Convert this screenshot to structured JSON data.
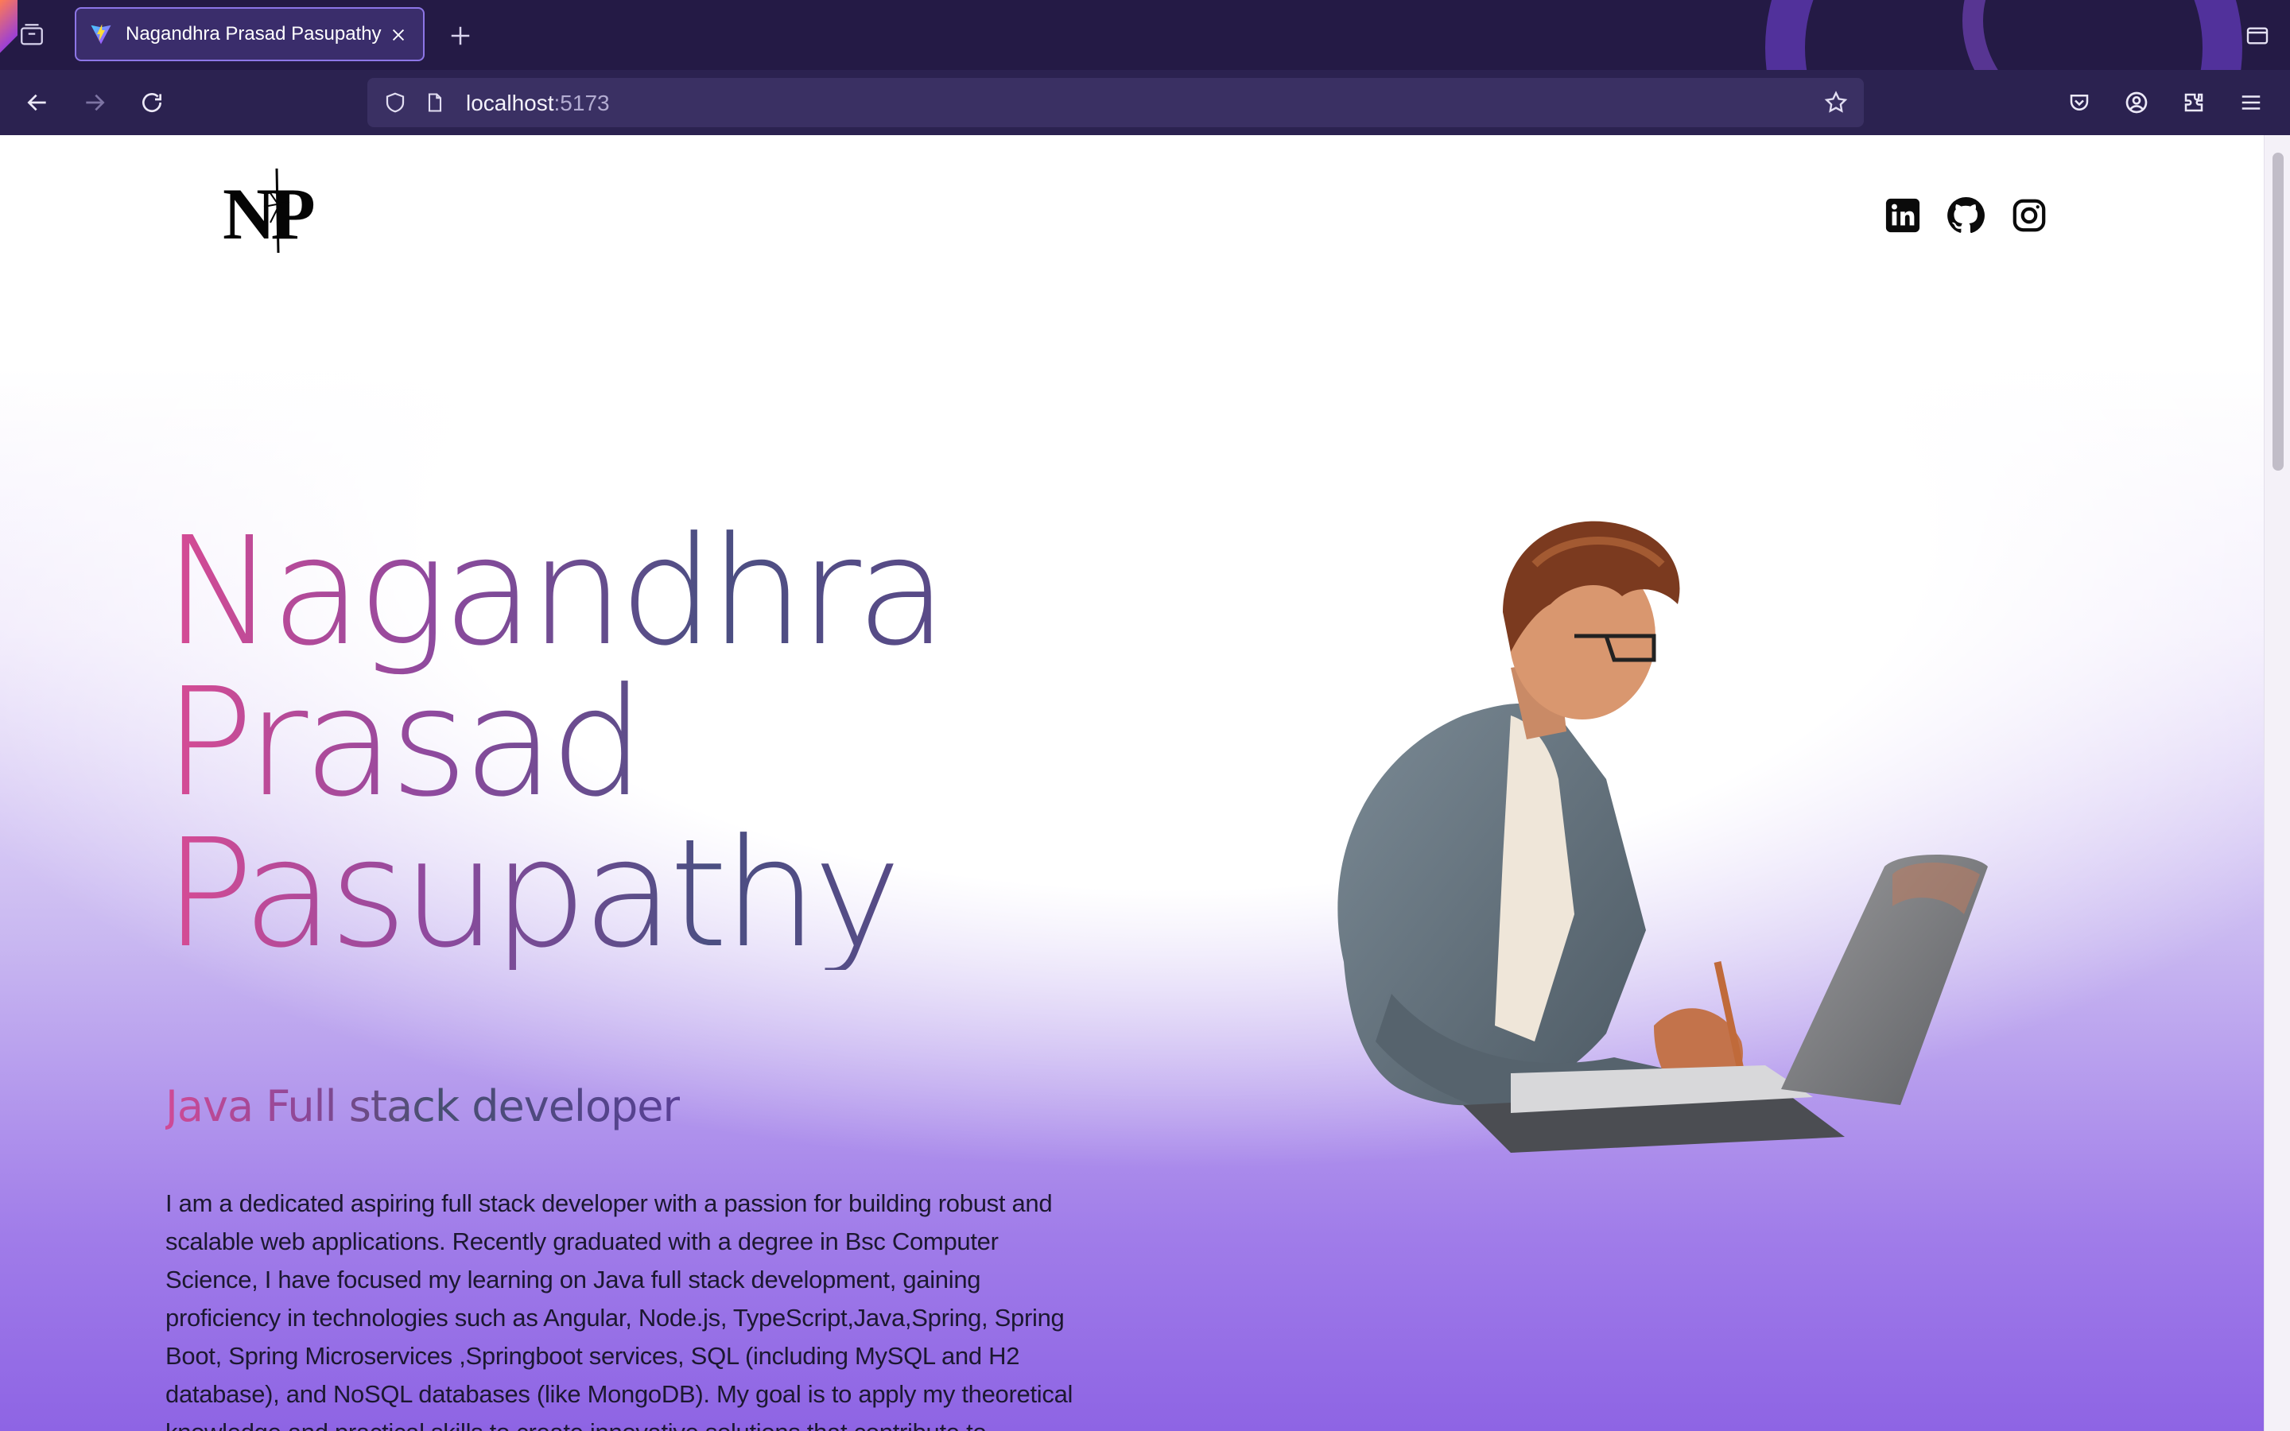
{
  "browser": {
    "tab_title": "Nagandhra Prasad Pasupathy",
    "url_host": "localhost",
    "url_port": ":5173"
  },
  "page": {
    "logo_text": "NP",
    "name_lines": [
      "Nagandhra",
      "Prasad",
      "Pasupathy"
    ],
    "role": "Java Full stack developer",
    "bio": "I am a dedicated aspiring full stack developer with a passion for building robust and scalable web applications. Recently graduated with a degree in Bsc Computer Science, I have focused my learning on Java full stack development, gaining proficiency in technologies such as Angular, Node.js, TypeScript,Java,Spring, Spring Boot, Spring Microservices ,Springboot services, SQL (including MySQL and H2 database), and NoSQL databases (like MongoDB). My goal is to apply my theoretical knowledge and practical skills to create innovative solutions that contribute to business success through digital",
    "social_icons": [
      "linkedin-icon",
      "github-icon",
      "instagram-icon"
    ]
  },
  "colors": {
    "tabbar_bg": "#241a45",
    "navbar_bg": "#2b2250",
    "gradient_pink": "#d84b94",
    "gradient_slate": "#4b4f82",
    "page_purple": "#8e64e4"
  }
}
